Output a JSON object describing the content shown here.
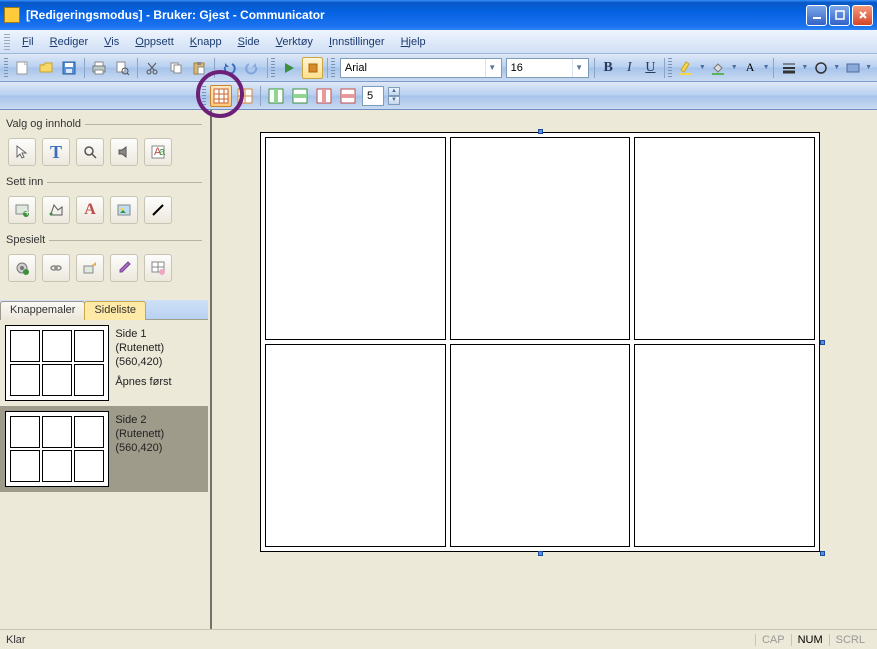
{
  "titlebar": {
    "title": "[Redigeringsmodus] - Bruker: Gjest - Communicator"
  },
  "menu": {
    "fil": "Fil",
    "rediger": "Rediger",
    "vis": "Vis",
    "oppsett": "Oppsett",
    "knapp": "Knapp",
    "side": "Side",
    "verktoy": "Verktøy",
    "innstillinger": "Innstillinger",
    "hjelp": "Hjelp"
  },
  "toolbar": {
    "font": "Arial",
    "size": "16",
    "bold": "B",
    "italic": "I",
    "underline": "U"
  },
  "toolbar2": {
    "spin": "5"
  },
  "sidebar": {
    "group1": "Valg og innhold",
    "group2": "Sett inn",
    "group3": "Spesielt",
    "tab1": "Knappemaler",
    "tab2": "Sideliste",
    "pages": [
      {
        "title": "Side 1 (Rutenett)",
        "dims": "(560,420)",
        "note": "Åpnes først"
      },
      {
        "title": "Side 2 (Rutenett)",
        "dims": "(560,420)",
        "note": ""
      }
    ]
  },
  "status": {
    "ready": "Klar",
    "cap": "CAP",
    "num": "NUM",
    "scrl": "SCRL"
  }
}
